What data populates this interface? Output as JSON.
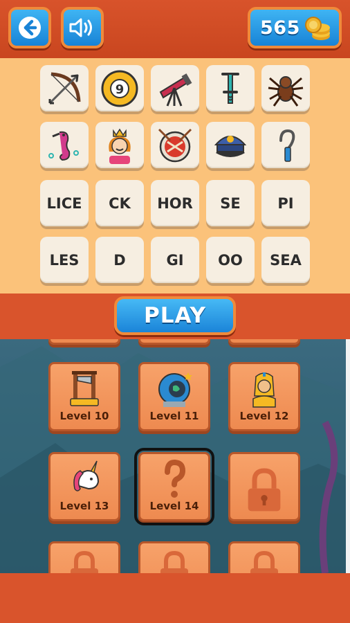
{
  "header": {
    "back_icon": "arrow-left-icon",
    "sound_icon": "speaker-icon",
    "coins": "565",
    "coin_icon": "coin-stack-icon"
  },
  "puzzle": {
    "picture_tiles": [
      "bow-and-arrow",
      "billiard-ball-9",
      "telescope",
      "pogo-stick",
      "tarantula",
      "seahorse",
      "princess",
      "drum",
      "police-cap",
      "hook"
    ],
    "ball_number": "9",
    "letter_tiles": [
      "LICE",
      "CK",
      "HOR",
      "SE",
      "PI",
      "LES",
      "D",
      "GI",
      "OO",
      "SEA"
    ]
  },
  "play": {
    "label": "PLAY"
  },
  "levels": [
    {
      "label": "Level 10",
      "icon": "guillotine-icon"
    },
    {
      "label": "Level 11",
      "icon": "astronaut-helmet-icon"
    },
    {
      "label": "Level 12",
      "icon": "pharaoh-icon"
    },
    {
      "label": "Level 13",
      "icon": "unicorn-icon"
    },
    {
      "label": "Level 14",
      "icon": "question-mark-icon"
    },
    {
      "label": "",
      "icon": "lock-icon"
    }
  ],
  "colors": {
    "accent_blue": "#1e8ee0",
    "orange": "#d9542c",
    "tile": "#f6eee1",
    "panel": "#fbc27a"
  }
}
